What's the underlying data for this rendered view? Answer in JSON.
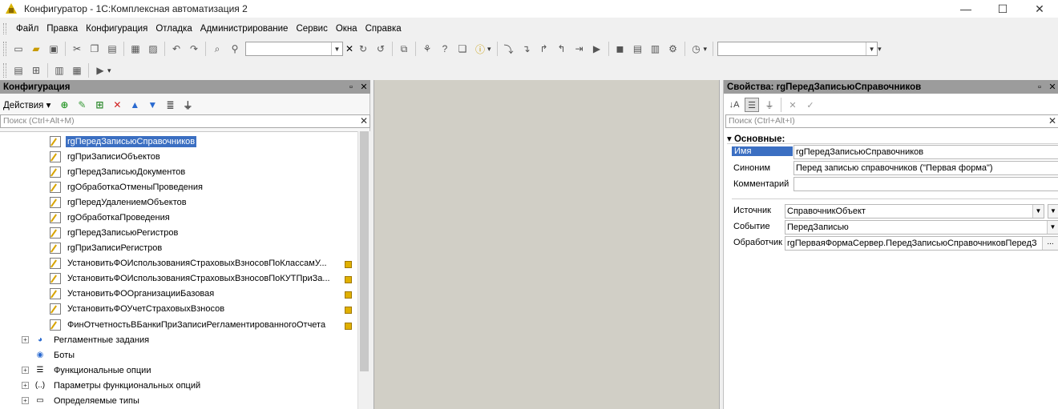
{
  "window": {
    "title": "Конфигуратор - 1С:Комплексная автоматизация 2",
    "minimize": "—",
    "maximize": "☐",
    "close": "✕"
  },
  "menu": [
    "Файл",
    "Правка",
    "Конфигурация",
    "Отладка",
    "Администрирование",
    "Сервис",
    "Окна",
    "Справка"
  ],
  "toolbar": {
    "search_value": "",
    "combo2_value": ""
  },
  "config_panel": {
    "title": "Конфигурация",
    "pin": "▫",
    "close": "✕",
    "actions_label": "Действия ▾",
    "search_placeholder": "Поиск (Ctrl+Alt+M)",
    "search_clear": "✕",
    "tree_items": [
      "rgПередЗаписьюСправочников",
      "rgПриЗаписиОбъектов",
      "rgПередЗаписьюДокументов",
      "rgОбработкаОтменыПроведения",
      "rgПередУдалениемОбъектов",
      "rgОбработкаПроведения",
      "rgПередЗаписьюРегистров",
      "rgПриЗаписиРегистров",
      "УстановитьФОИспользованияСтраховыхВзносовПоКлассамУ...",
      "УстановитьФОИспользованияСтраховыхВзносовПоКУТПриЗа...",
      "УстановитьФООрганизацииБазовая",
      "УстановитьФОУчетСтраховыхВзносов",
      "ФинОтчетностьВБанкиПриЗаписиРегламентированногоОтчета"
    ],
    "groups": [
      "Регламентные задания",
      "Боты",
      "Функциональные опции",
      "Параметры функциональных опций",
      "Определяемые типы"
    ]
  },
  "props_panel": {
    "title": "Свойства: rgПередЗаписьюСправочников",
    "pin": "▫",
    "close": "✕",
    "search_placeholder": "Поиск (Ctrl+Alt+I)",
    "search_clear": "✕",
    "section": "▾ Основные:",
    "fields": {
      "name_label": "Имя",
      "name_value": "rgПередЗаписьюСправочников",
      "synonym_label": "Синоним",
      "synonym_value": "Перед записью справочников (\"Первая форма\")",
      "comment_label": "Комментарий",
      "comment_value": "",
      "source_label": "Источник",
      "source_value": "СправочникОбъект",
      "event_label": "Событие",
      "event_value": "ПередЗаписью",
      "handler_label": "Обработчик",
      "handler_value": "rgПерваяФормаСервер.ПередЗаписьюСправочниковПередЗ",
      "ellipsis": "..."
    }
  },
  "colors": {
    "selection": "#3b6fc2",
    "panel_header": "#9c9c9c",
    "workspace": "#d1cfc6"
  }
}
